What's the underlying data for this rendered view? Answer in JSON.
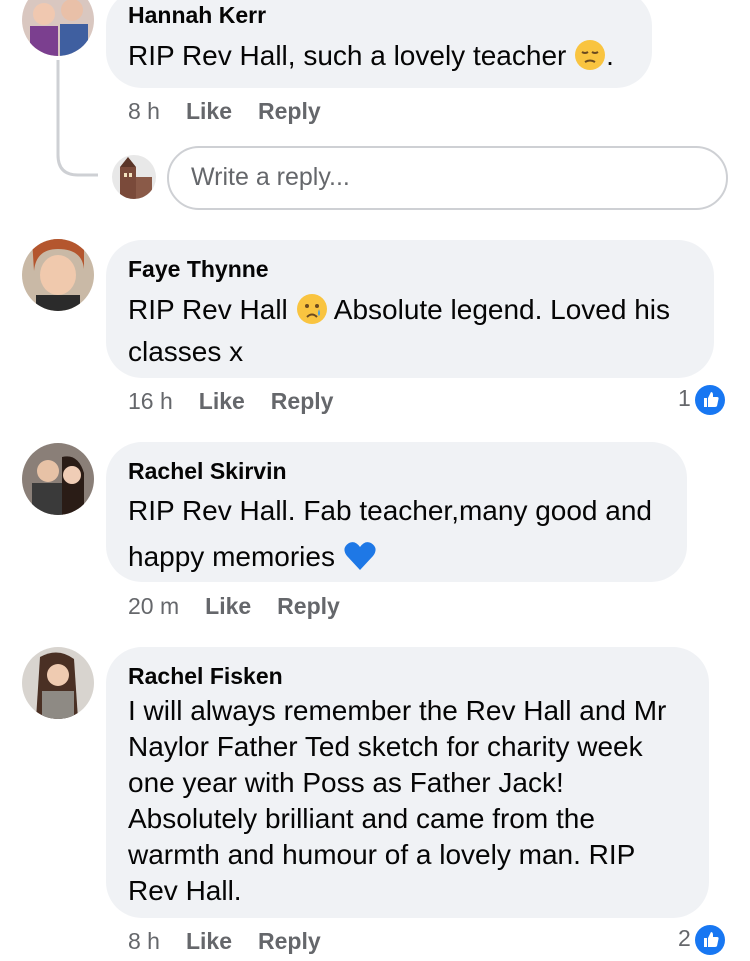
{
  "comments": [
    {
      "name": "Hannah Kerr",
      "text": "RIP Rev Hall, such a lovely teacher",
      "text_after_emoji": ".",
      "emoji": "pensive-face",
      "time": "8 h",
      "like_label": "Like",
      "reply_label": "Reply"
    },
    {
      "name": "Faye Thynne",
      "text_before_emoji": "RIP Rev Hall",
      "emoji": "crying-face",
      "text_after_emoji": "Absolute legend. Loved his",
      "text_line2": "classes x",
      "time": "16 h",
      "like_label": "Like",
      "reply_label": "Reply",
      "like_count": "1"
    },
    {
      "name": "Rachel Skirvin",
      "text_line1": "RIP Rev Hall. Fab teacher,many good and",
      "text_line2": "happy memories",
      "emoji": "blue-heart",
      "time": "20 m",
      "like_label": "Like",
      "reply_label": "Reply"
    },
    {
      "name": "Rachel Fisken",
      "text": "I will always remember the Rev Hall and Mr\nNaylor Father Ted sketch for charity week\none year with Poss as Father Jack!\nAbsolutely brilliant and came from the\nwarmth and humour of a lovely man. RIP\nRev Hall.",
      "time": "8 h",
      "like_label": "Like",
      "reply_label": "Reply",
      "like_count": "2"
    }
  ],
  "reply_box": {
    "placeholder": "Write a reply..."
  },
  "colors": {
    "bubble": "#f0f2f5",
    "meta": "#65676b",
    "like_blue": "#1877f2"
  }
}
